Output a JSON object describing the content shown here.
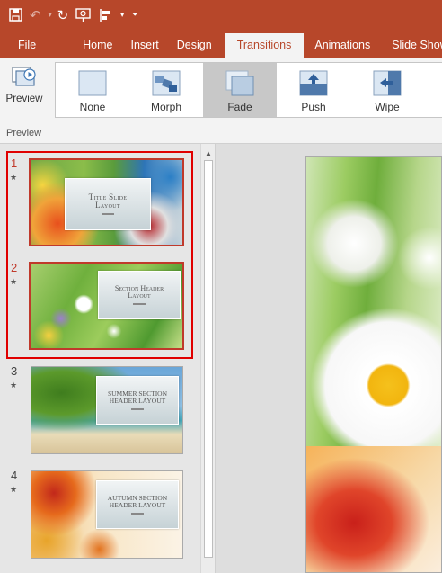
{
  "ribbon_tabs": [
    "File",
    "Home",
    "Insert",
    "Design",
    "Transitions",
    "Animations",
    "Slide Show"
  ],
  "active_tab": "Transitions",
  "preview": {
    "button_label": "Preview",
    "group_label": "Preview"
  },
  "transitions": [
    {
      "label": "None",
      "icon": "none-transition-icon",
      "selected": false
    },
    {
      "label": "Morph",
      "icon": "morph-transition-icon",
      "selected": false
    },
    {
      "label": "Fade",
      "icon": "fade-transition-icon",
      "selected": true
    },
    {
      "label": "Push",
      "icon": "push-transition-icon",
      "selected": false
    },
    {
      "label": "Wipe",
      "icon": "wipe-transition-icon",
      "selected": false
    }
  ],
  "slides": [
    {
      "number": "1",
      "title": "Title Slide Layout",
      "selected": true,
      "has_transition": true
    },
    {
      "number": "2",
      "title": "Section Header Layout",
      "selected": true,
      "has_transition": true
    },
    {
      "number": "3",
      "title": "Summer Section Header Layout",
      "selected": false,
      "has_transition": true
    },
    {
      "number": "4",
      "title": "Autumn Section Header Layout",
      "selected": false,
      "has_transition": true
    }
  ],
  "colors": {
    "accent": "#b7472a",
    "selection": "#e00000"
  }
}
